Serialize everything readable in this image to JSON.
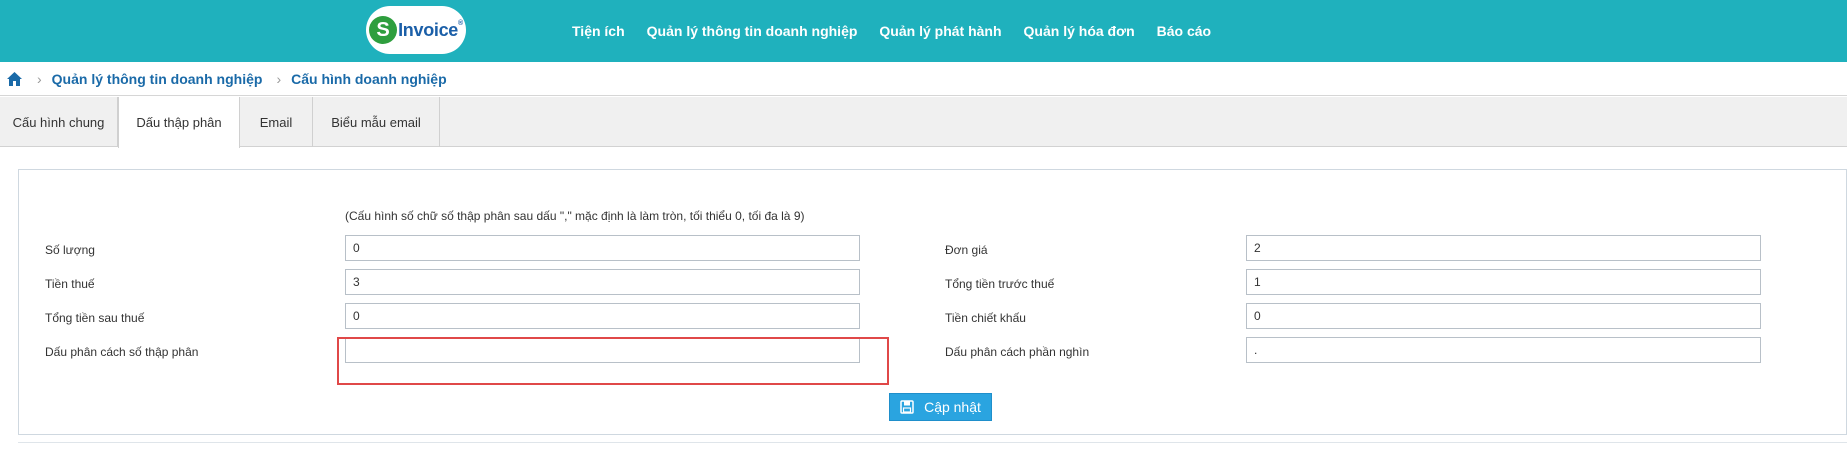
{
  "header": {
    "logo": {
      "mark": "S",
      "text": "Invoice",
      "sup": "®"
    },
    "nav": [
      {
        "label": "Tiện ích"
      },
      {
        "label": "Quản lý thông tin doanh nghiệp"
      },
      {
        "label": "Quản lý phát hành"
      },
      {
        "label": "Quản lý hóa đơn"
      },
      {
        "label": "Báo cáo"
      }
    ]
  },
  "breadcrumb": {
    "home_icon": "home-icon",
    "items": [
      "Quản lý thông tin doanh nghiệp",
      "Cấu hình doanh nghiệp"
    ]
  },
  "tabs": [
    {
      "label": "Cấu hình chung",
      "active": false
    },
    {
      "label": "Dấu thập phân",
      "active": true
    },
    {
      "label": "Email",
      "active": false
    },
    {
      "label": "Biểu mẫu email",
      "active": false
    }
  ],
  "form": {
    "note": "(Cấu hình số chữ số thập phân sau dấu \",\" mặc định là làm tròn, tối thiểu 0, tối đa là 9)",
    "left": [
      {
        "label": "Số lượng",
        "value": "0"
      },
      {
        "label": "Tiền thuế",
        "value": "3"
      },
      {
        "label": "Tổng tiền sau thuế",
        "value": "0"
      },
      {
        "label": "Dấu phân cách số thập phân",
        "value": ""
      }
    ],
    "right": [
      {
        "label": "Đơn giá",
        "value": "2"
      },
      {
        "label": "Tổng tiền trước thuế",
        "value": "1"
      },
      {
        "label": "Tiền chiết khấu",
        "value": "0"
      },
      {
        "label": "Dấu phân cách phần nghìn",
        "value": "."
      }
    ],
    "submit_label": "Cập nhật"
  },
  "colors": {
    "header_bg": "#1fb1bd",
    "link": "#1a6aa8",
    "button": "#2aa4e0",
    "highlight": "#e04848"
  }
}
